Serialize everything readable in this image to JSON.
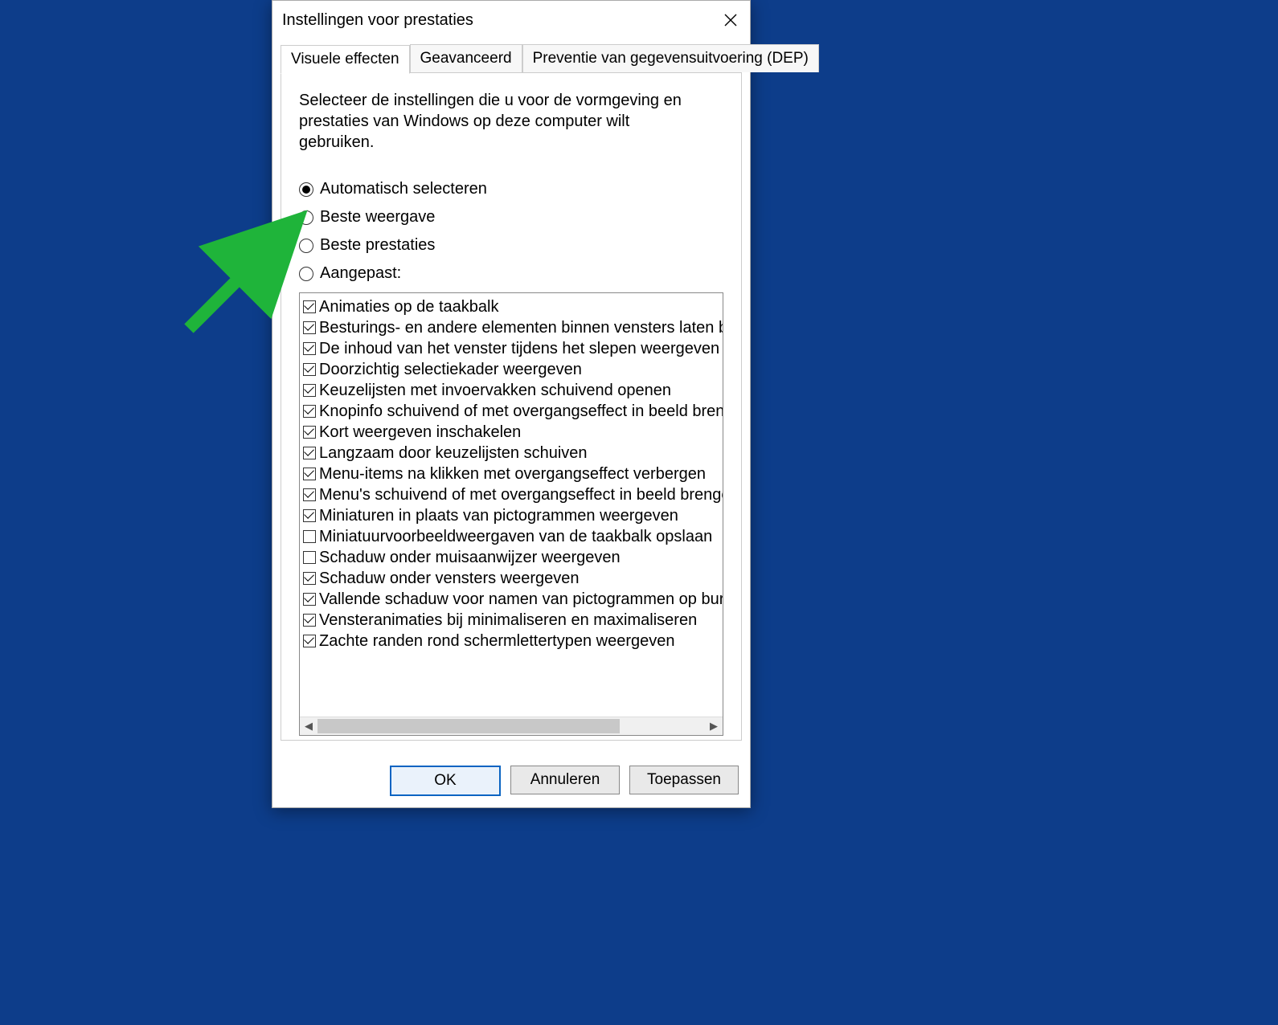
{
  "dialog": {
    "title": "Instellingen voor prestaties"
  },
  "tabs": {
    "visual": "Visuele effecten",
    "advanced": "Geavanceerd",
    "dep": "Preventie van gegevensuitvoering (DEP)"
  },
  "intro": "Selecteer de instellingen die u voor de vormgeving en prestaties van Windows op deze computer wilt gebruiken.",
  "radios": {
    "auto": "Automatisch selecteren",
    "best_appearance": "Beste weergave",
    "best_performance": "Beste prestaties",
    "custom": "Aangepast:",
    "selected": "auto"
  },
  "checks": [
    {
      "checked": true,
      "label": "Animaties op de taakbalk"
    },
    {
      "checked": true,
      "label": "Besturings- en andere elementen binnen vensters laten bewe"
    },
    {
      "checked": true,
      "label": "De inhoud van het venster tijdens het slepen weergeven"
    },
    {
      "checked": true,
      "label": "Doorzichtig selectiekader weergeven"
    },
    {
      "checked": true,
      "label": "Keuzelijsten met invoervakken schuivend openen"
    },
    {
      "checked": true,
      "label": "Knopinfo schuivend of met overgangseffect in beeld brengen"
    },
    {
      "checked": true,
      "label": "Kort weergeven inschakelen"
    },
    {
      "checked": true,
      "label": "Langzaam door keuzelijsten schuiven"
    },
    {
      "checked": true,
      "label": "Menu-items na klikken met overgangseffect verbergen"
    },
    {
      "checked": true,
      "label": "Menu's schuivend of met overgangseffect in beeld brengen"
    },
    {
      "checked": true,
      "label": "Miniaturen in plaats van pictogrammen weergeven"
    },
    {
      "checked": false,
      "label": "Miniatuurvoorbeeldweergaven van de taakbalk opslaan"
    },
    {
      "checked": false,
      "label": "Schaduw onder muisaanwijzer weergeven"
    },
    {
      "checked": true,
      "label": "Schaduw onder vensters weergeven"
    },
    {
      "checked": true,
      "label": "Vallende schaduw voor namen van pictogrammen op bureau"
    },
    {
      "checked": true,
      "label": "Vensteranimaties bij minimaliseren en maximaliseren"
    },
    {
      "checked": true,
      "label": "Zachte randen rond schermlettertypen weergeven"
    }
  ],
  "buttons": {
    "ok": "OK",
    "cancel": "Annuleren",
    "apply": "Toepassen"
  }
}
